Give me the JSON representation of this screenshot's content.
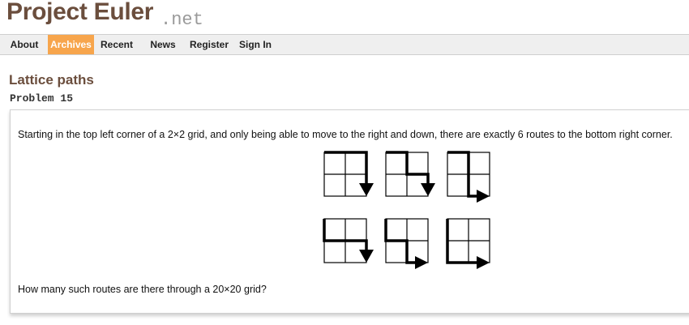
{
  "logo": {
    "main": "Project Euler",
    "suffix": ".net"
  },
  "nav": {
    "items": [
      {
        "label": "About",
        "active": false
      },
      {
        "label": "Archives",
        "active": true
      },
      {
        "label": "Recent",
        "active": false
      },
      {
        "label": "News",
        "active": false
      },
      {
        "label": "Register",
        "active": false
      },
      {
        "label": "Sign In",
        "active": false
      }
    ]
  },
  "problem": {
    "title": "Lattice paths",
    "number": "Problem 15",
    "intro": "Starting in the top left corner of a 2×2 grid, and only being able to move to the right and down, there are exactly 6 routes to the bottom right corner.",
    "question": "How many such routes are there through a 20×20 grid?"
  },
  "colors": {
    "accent": "#f7a54c",
    "logo": "#6b4e3d"
  }
}
